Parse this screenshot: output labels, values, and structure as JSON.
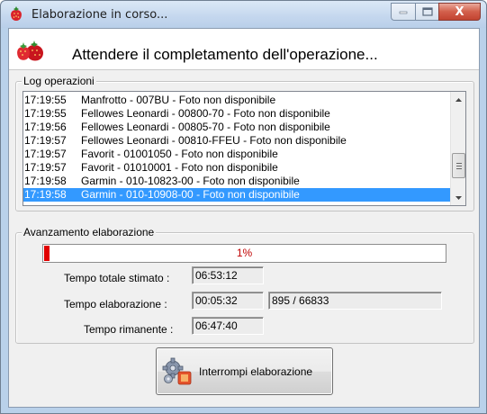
{
  "window": {
    "title": "Elaborazione in corso...",
    "icon": "strawberry-icon",
    "controls": {
      "minimize": "minimize-icon",
      "maximize": "maximize-icon",
      "close": "X"
    }
  },
  "header": {
    "title": "Attendere il completamento dell'operazione...",
    "icon": "strawberries-icon"
  },
  "log": {
    "legend": "Log operazioni",
    "entries": [
      {
        "time": "17:19:55",
        "message": "Manfrotto - 007BU - Foto non disponibile"
      },
      {
        "time": "17:19:55",
        "message": "Fellowes Leonardi - 00800-70 - Foto non disponibile"
      },
      {
        "time": "17:19:56",
        "message": "Fellowes Leonardi - 00805-70 - Foto non disponibile"
      },
      {
        "time": "17:19:57",
        "message": "Fellowes Leonardi - 00810-FFEU - Foto non disponibile"
      },
      {
        "time": "17:19:57",
        "message": "Favorit - 01001050 - Foto non disponibile"
      },
      {
        "time": "17:19:57",
        "message": "Favorit - 01010001 - Foto non disponibile"
      },
      {
        "time": "17:19:58",
        "message": "Garmin - 010-10823-00 - Foto non disponibile"
      },
      {
        "time": "17:19:58",
        "message": "Garmin - 010-10908-00 - Foto non disponibile"
      }
    ],
    "selected_index": 7,
    "scroll_position": 0.8
  },
  "progress": {
    "legend": "Avanzamento elaborazione",
    "percent_text": "1%",
    "fraction": 0.013,
    "bar_color": "#e00000",
    "text_color": "#c00000"
  },
  "times": {
    "total_label": "Tempo totale stimato :",
    "total_value": "06:53:12",
    "elapsed_label": "Tempo elaborazione :",
    "elapsed_value": "00:05:32",
    "count_value": "895 / 66833",
    "remaining_label": "Tempo rimanente :",
    "remaining_value": "06:47:40"
  },
  "actions": {
    "stop_label": "Interrompi elaborazione",
    "stop_icon": "gears-stop-icon"
  },
  "colors": {
    "selection": "#3399ff",
    "frame": "#b9d1ea",
    "dialog": "#f0f0f0"
  }
}
